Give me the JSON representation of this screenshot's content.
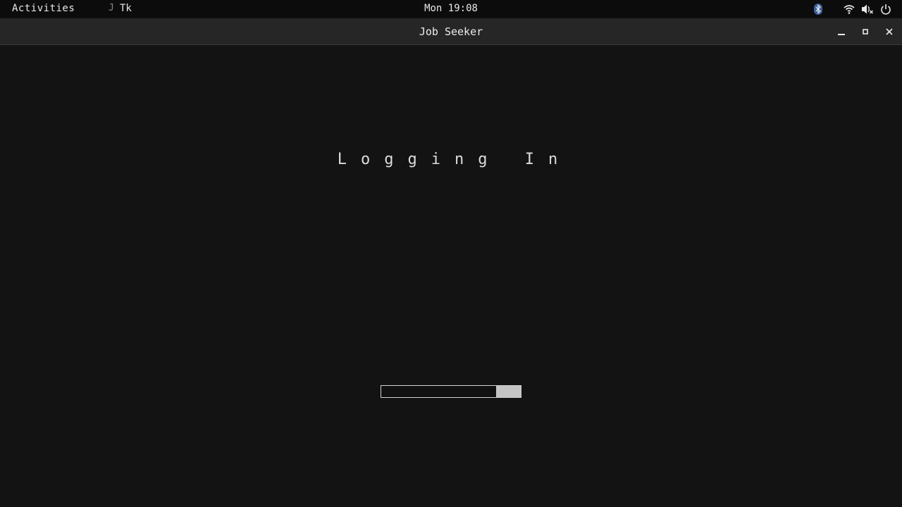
{
  "topbar": {
    "activities_label": "Activities",
    "app_name": "Tk",
    "app_icon_glyph": "J",
    "clock": "Mon 19:08",
    "tray_icons": [
      "bluetooth-icon",
      "wifi-icon",
      "volume-muted-icon",
      "power-icon"
    ]
  },
  "window": {
    "title": "Job Seeker",
    "controls": [
      "minimize",
      "maximize",
      "close"
    ]
  },
  "main": {
    "status_text": "Logging In",
    "progress": {
      "indicator_start_fraction": 0.825,
      "indicator_end_fraction": 1.0
    }
  },
  "colors": {
    "background": "#131313",
    "topbar": "#0c0c0c",
    "titlebar": "#262626",
    "progress_fill": "#c4c4c4",
    "bluetooth_accent": "#7aa7e6"
  }
}
